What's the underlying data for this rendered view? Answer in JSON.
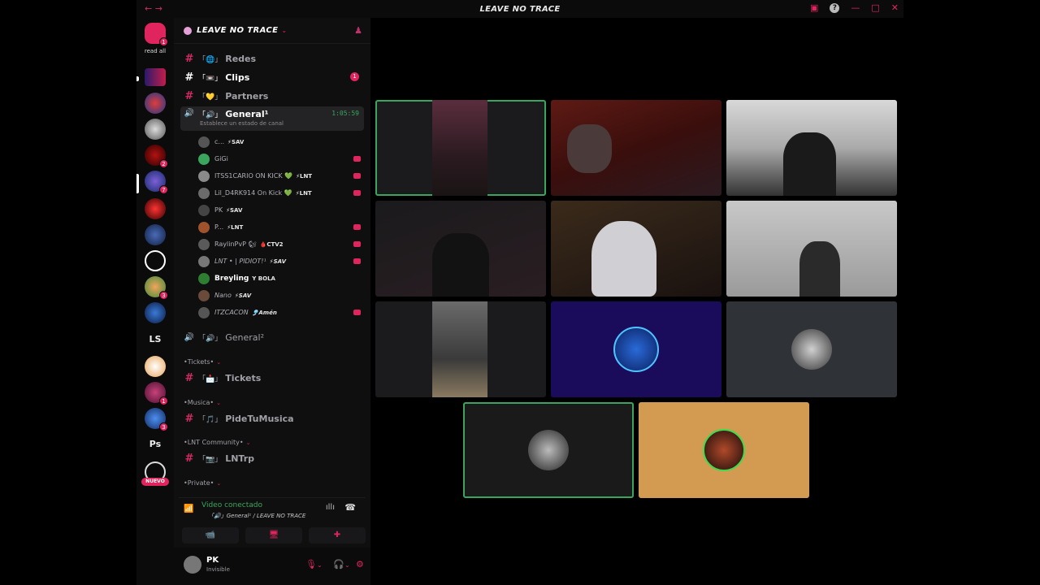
{
  "window": {
    "title": "LEAVE NO TRACE",
    "nav_arrows": "← →",
    "colors": {
      "accent": "#e0245e",
      "connected": "#3ba55d",
      "bg": "#000000"
    }
  },
  "servers": {
    "read_all_label": "read all",
    "home_badge": "1",
    "text_items": [
      "LS",
      "Ps"
    ],
    "badges": {
      "b1": "2",
      "b2": "7",
      "b3": "3",
      "b4": "1",
      "b5": "3"
    },
    "nuevo_label": "NUEVO"
  },
  "guild": {
    "name": "LEAVE NO TRACE",
    "channels": {
      "redes": {
        "emoji": "「🌐」",
        "name": "Redes"
      },
      "clips": {
        "emoji": "「📼」",
        "name": "Clips",
        "unread": "1"
      },
      "partners": {
        "emoji": "「💛」",
        "name": "Partners"
      },
      "general1": {
        "emoji": "「🔊」",
        "name": "General¹",
        "time": "1:05:59",
        "status": "Establece un estado de canal"
      },
      "general2": {
        "emoji": "「🔊」",
        "name": "General²"
      },
      "tickets": {
        "emoji": "「📩」",
        "name": "Tickets"
      },
      "pidetumusica": {
        "emoji": "「🎵」",
        "name": "PideTuMusica"
      },
      "lntrp": {
        "emoji": "「📷」",
        "name": "LNTrp"
      }
    },
    "categories": {
      "tickets": "•Tickets•",
      "musica": "•Musica•",
      "lnt": "•LNT Community•",
      "private": "•Private•"
    },
    "voice_users": [
      {
        "name": "c...",
        "tag": "⚡SAV"
      },
      {
        "name": "GiGi",
        "tag": ""
      },
      {
        "name": "ITSS1CARIO ON KICK 💚",
        "tag": "⚡LNT"
      },
      {
        "name": "Lil_D4RK914 On Kick 💚",
        "tag": "⚡LNT"
      },
      {
        "name": "PK",
        "tag": "⚡SAV"
      },
      {
        "name": "P...",
        "tag": "⚡LNT"
      },
      {
        "name": "RaylinPvP 🐿",
        "tag": "🩸CTV2"
      },
      {
        "name": "LNT • | PIDIOT!¹",
        "tag": "⚡SAV"
      },
      {
        "name": "Breyling",
        "tag": "Y BOLA"
      },
      {
        "name": "Nano",
        "tag": "⚡SAV"
      },
      {
        "name": "ITZCACON",
        "tag": "🎐Amén"
      }
    ]
  },
  "rtc": {
    "status": "Video conectado",
    "location": "「🔊」General¹ / LEAVE NO TRACE",
    "buttons": {
      "camera": "📹",
      "screen": "🖥",
      "activity": "✚"
    }
  },
  "user_panel": {
    "name": "PK",
    "status": "Invisible"
  },
  "icons": {
    "hash": "#",
    "speaker": "🔊",
    "caret": "⌄",
    "mic": "🎙",
    "headset": "🎧",
    "gear": "⚙",
    "signal": "📶",
    "noise": "ıllı",
    "hangup": "☎"
  }
}
